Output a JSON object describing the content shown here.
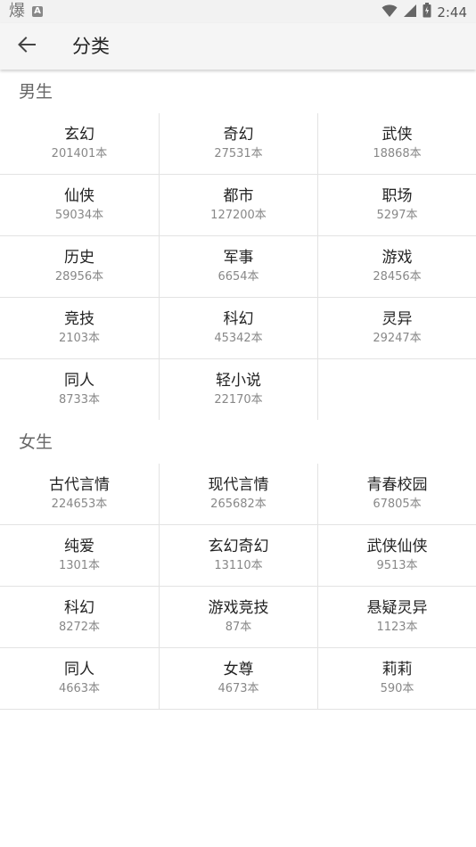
{
  "status_bar": {
    "left_glyph": "爆",
    "left_badge": "A",
    "time": "2:44"
  },
  "app_bar": {
    "title": "分类"
  },
  "sections": [
    {
      "title": "男生",
      "rows": [
        [
          {
            "name": "玄幻",
            "count": "201401本"
          },
          {
            "name": "奇幻",
            "count": "27531本"
          },
          {
            "name": "武侠",
            "count": "18868本"
          }
        ],
        [
          {
            "name": "仙侠",
            "count": "59034本"
          },
          {
            "name": "都市",
            "count": "127200本"
          },
          {
            "name": "职场",
            "count": "5297本"
          }
        ],
        [
          {
            "name": "历史",
            "count": "28956本"
          },
          {
            "name": "军事",
            "count": "6654本"
          },
          {
            "name": "游戏",
            "count": "28456本"
          }
        ],
        [
          {
            "name": "竞技",
            "count": "2103本"
          },
          {
            "name": "科幻",
            "count": "45342本"
          },
          {
            "name": "灵异",
            "count": "29247本"
          }
        ],
        [
          {
            "name": "同人",
            "count": "8733本"
          },
          {
            "name": "轻小说",
            "count": "22170本"
          }
        ]
      ]
    },
    {
      "title": "女生",
      "rows": [
        [
          {
            "name": "古代言情",
            "count": "224653本"
          },
          {
            "name": "现代言情",
            "count": "265682本"
          },
          {
            "name": "青春校园",
            "count": "67805本"
          }
        ],
        [
          {
            "name": "纯爱",
            "count": "1301本"
          },
          {
            "name": "玄幻奇幻",
            "count": "13110本"
          },
          {
            "name": "武侠仙侠",
            "count": "9513本"
          }
        ],
        [
          {
            "name": "科幻",
            "count": "8272本"
          },
          {
            "name": "游戏竞技",
            "count": "87本"
          },
          {
            "name": "悬疑灵异",
            "count": "1123本"
          }
        ],
        [
          {
            "name": "同人",
            "count": "4663本"
          },
          {
            "name": "女尊",
            "count": "4673本"
          },
          {
            "name": "莉莉",
            "count": "590本"
          }
        ]
      ]
    }
  ]
}
